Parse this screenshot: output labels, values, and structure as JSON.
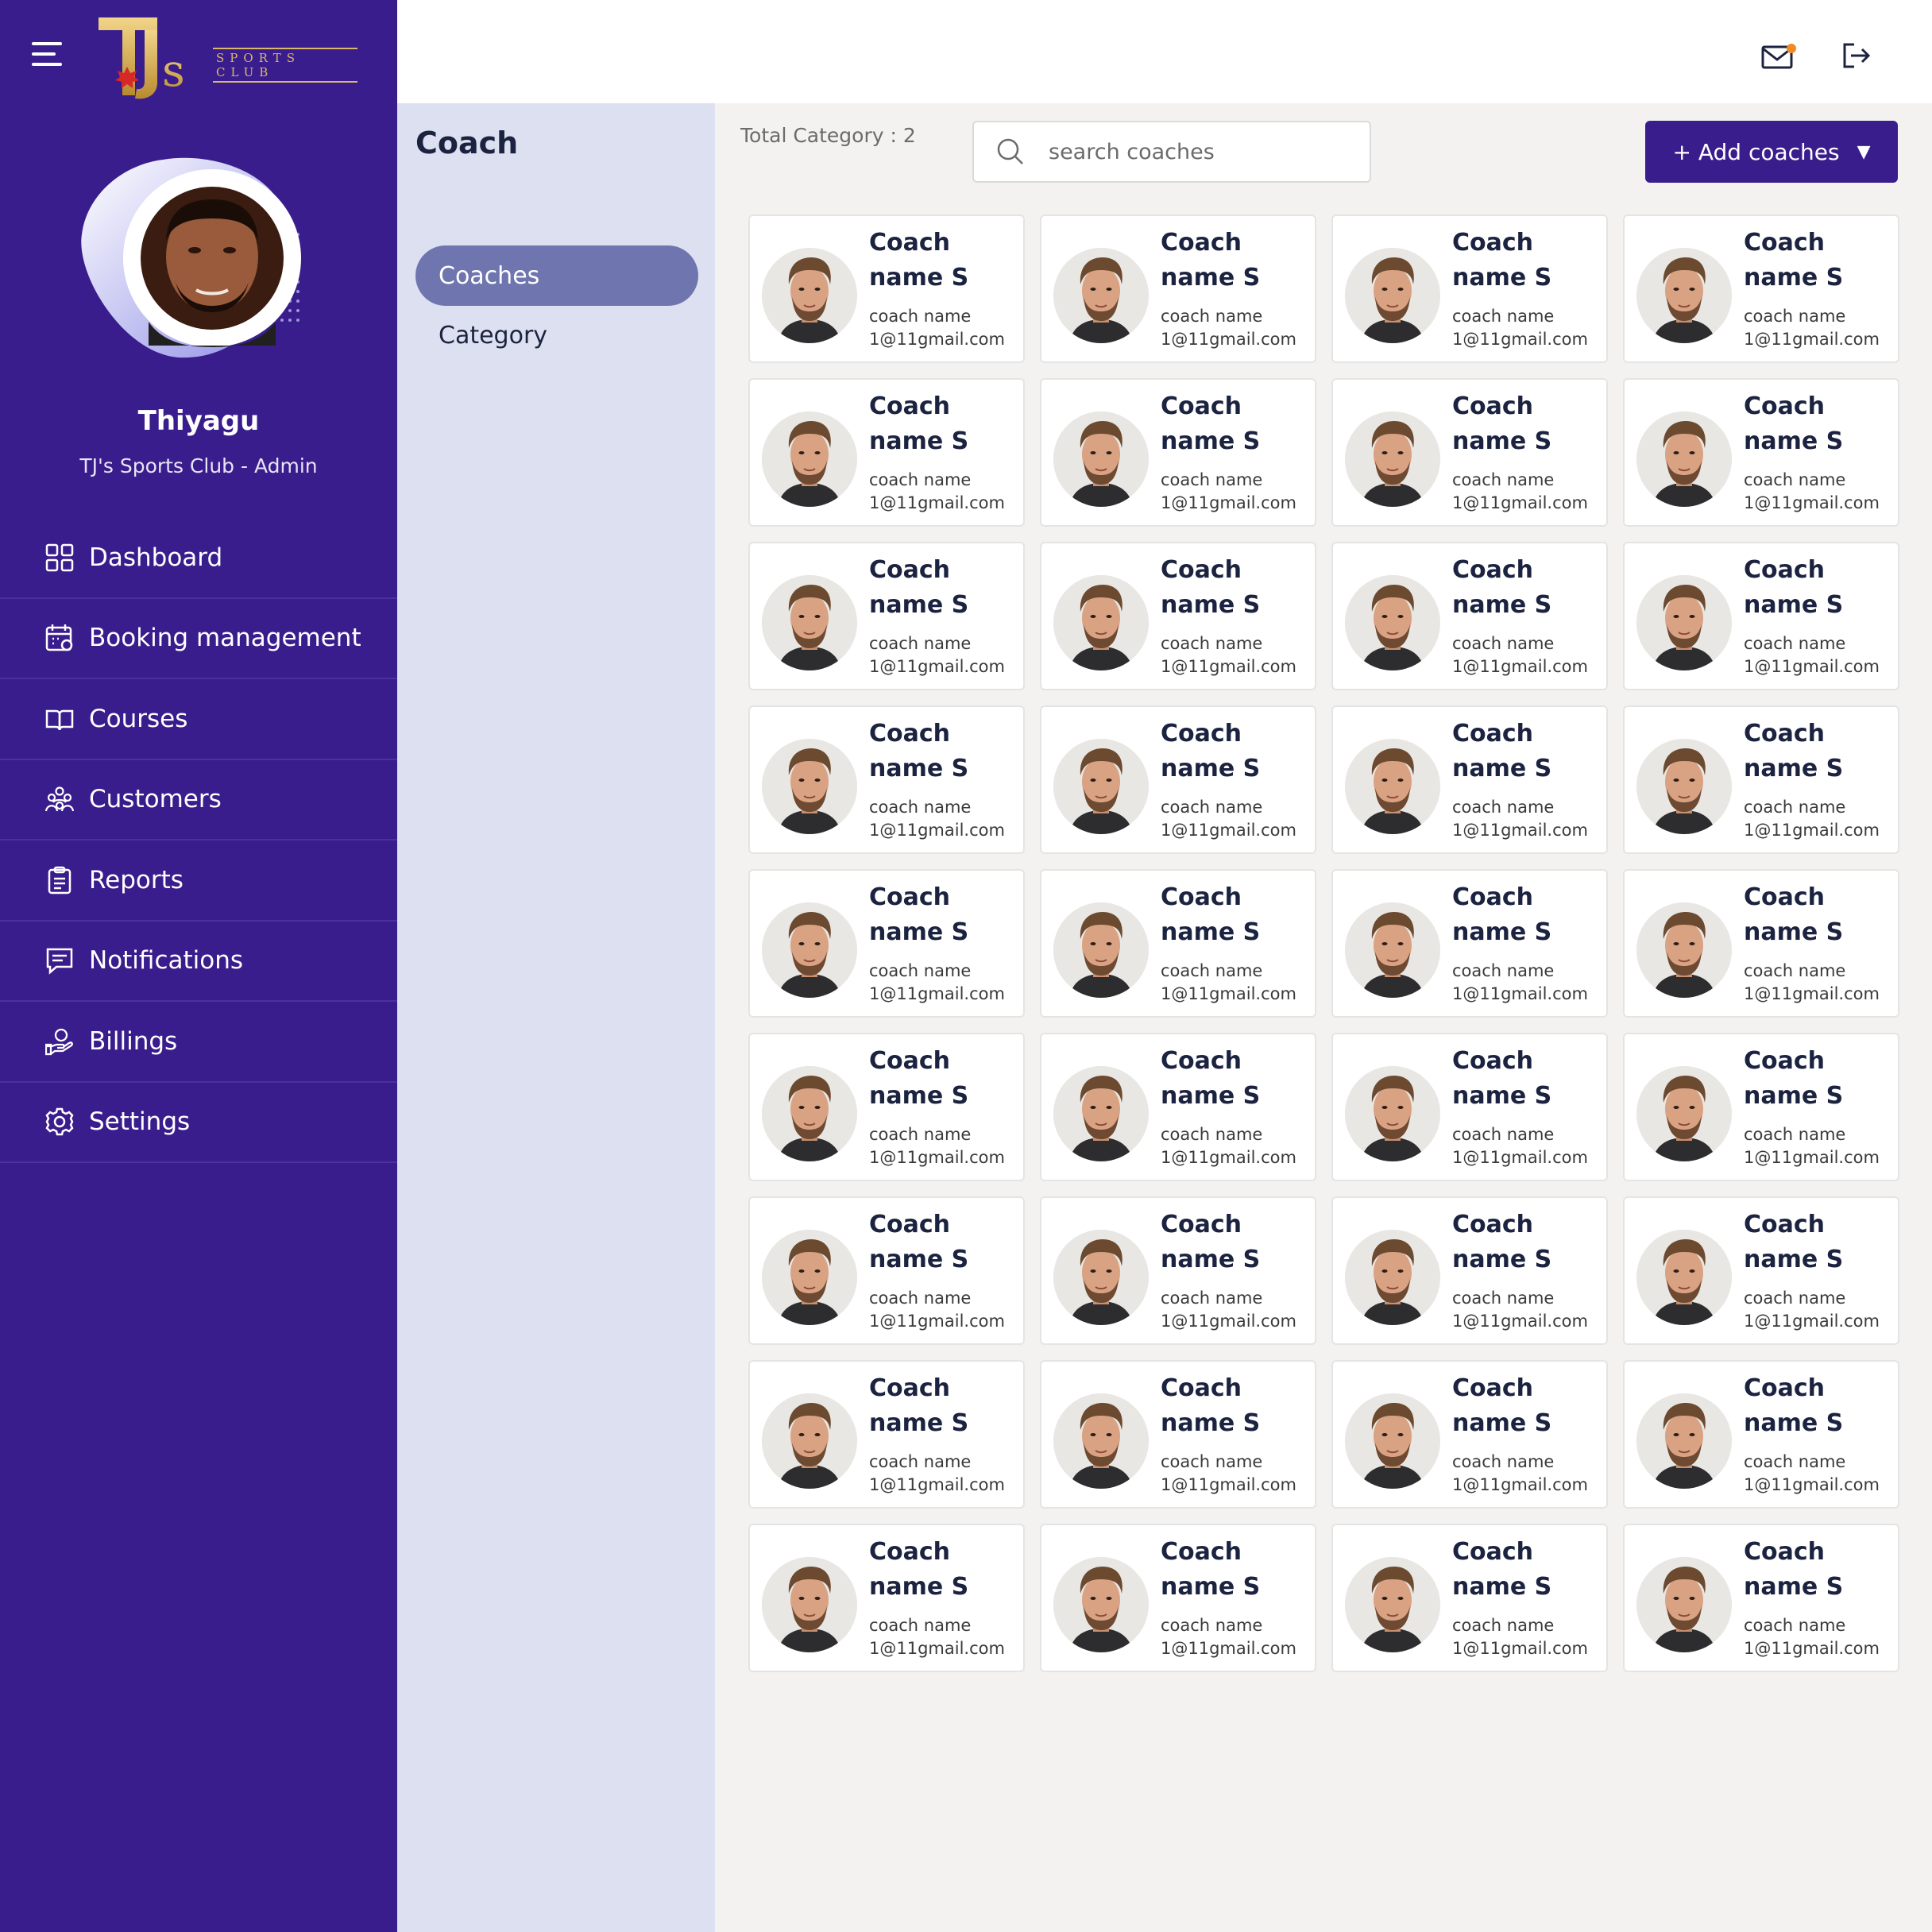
{
  "brand": {
    "logo_text": "SPORTS CLUB"
  },
  "user": {
    "name": "Thiyagu",
    "role": "TJ's Sports Club - Admin"
  },
  "nav": [
    {
      "label": "Dashboard",
      "icon": "dashboard-icon"
    },
    {
      "label": "Booking management",
      "icon": "calendar-icon"
    },
    {
      "label": "Courses",
      "icon": "book-icon"
    },
    {
      "label": "Customers",
      "icon": "users-icon"
    },
    {
      "label": "Reports",
      "icon": "clipboard-icon"
    },
    {
      "label": "Notifications",
      "icon": "chat-icon"
    },
    {
      "label": "Billings",
      "icon": "billing-hand-icon"
    },
    {
      "label": "Settings",
      "icon": "gear-icon"
    }
  ],
  "topbar": {
    "mail_icon": "mail-icon",
    "logout_icon": "logout-icon",
    "notification_dot_color": "#f08a24"
  },
  "subpanel": {
    "title": "Coach",
    "tabs": [
      {
        "label": "Coaches",
        "active": true
      },
      {
        "label": "Category",
        "active": false
      }
    ]
  },
  "main": {
    "total_category": "Total Category : 2",
    "search_placeholder": "search coaches",
    "add_button": "+ Add coaches",
    "cards": [
      {
        "name": "Coach name S",
        "subtitle": "coach name",
        "email": "1@11gmail.com"
      },
      {
        "name": "Coach name S",
        "subtitle": "coach name",
        "email": "1@11gmail.com"
      },
      {
        "name": "Coach name S",
        "subtitle": "coach name",
        "email": "1@11gmail.com"
      },
      {
        "name": "Coach name S",
        "subtitle": "coach name",
        "email": "1@11gmail.com"
      },
      {
        "name": "Coach name S",
        "subtitle": "coach name",
        "email": "1@11gmail.com"
      },
      {
        "name": "Coach name S",
        "subtitle": "coach name",
        "email": "1@11gmail.com"
      },
      {
        "name": "Coach name S",
        "subtitle": "coach name",
        "email": "1@11gmail.com"
      },
      {
        "name": "Coach name S",
        "subtitle": "coach name",
        "email": "1@11gmail.com"
      },
      {
        "name": "Coach name S",
        "subtitle": "coach name",
        "email": "1@11gmail.com"
      },
      {
        "name": "Coach name S",
        "subtitle": "coach name",
        "email": "1@11gmail.com"
      },
      {
        "name": "Coach name S",
        "subtitle": "coach name",
        "email": "1@11gmail.com"
      },
      {
        "name": "Coach name S",
        "subtitle": "coach name",
        "email": "1@11gmail.com"
      },
      {
        "name": "Coach name S",
        "subtitle": "coach name",
        "email": "1@11gmail.com"
      },
      {
        "name": "Coach name S",
        "subtitle": "coach name",
        "email": "1@11gmail.com"
      },
      {
        "name": "Coach name S",
        "subtitle": "coach name",
        "email": "1@11gmail.com"
      },
      {
        "name": "Coach name S",
        "subtitle": "coach name",
        "email": "1@11gmail.com"
      },
      {
        "name": "Coach name S",
        "subtitle": "coach name",
        "email": "1@11gmail.com"
      },
      {
        "name": "Coach name S",
        "subtitle": "coach name",
        "email": "1@11gmail.com"
      },
      {
        "name": "Coach name S",
        "subtitle": "coach name",
        "email": "1@11gmail.com"
      },
      {
        "name": "Coach name S",
        "subtitle": "coach name",
        "email": "1@11gmail.com"
      },
      {
        "name": "Coach name S",
        "subtitle": "coach name",
        "email": "1@11gmail.com"
      },
      {
        "name": "Coach name S",
        "subtitle": "coach name",
        "email": "1@11gmail.com"
      },
      {
        "name": "Coach name S",
        "subtitle": "coach name",
        "email": "1@11gmail.com"
      },
      {
        "name": "Coach name S",
        "subtitle": "coach name",
        "email": "1@11gmail.com"
      },
      {
        "name": "Coach name S",
        "subtitle": "coach name",
        "email": "1@11gmail.com"
      },
      {
        "name": "Coach name S",
        "subtitle": "coach name",
        "email": "1@11gmail.com"
      },
      {
        "name": "Coach name S",
        "subtitle": "coach name",
        "email": "1@11gmail.com"
      },
      {
        "name": "Coach name S",
        "subtitle": "coach name",
        "email": "1@11gmail.com"
      },
      {
        "name": "Coach name S",
        "subtitle": "coach name",
        "email": "1@11gmail.com"
      },
      {
        "name": "Coach name S",
        "subtitle": "coach name",
        "email": "1@11gmail.com"
      },
      {
        "name": "Coach name S",
        "subtitle": "coach name",
        "email": "1@11gmail.com"
      },
      {
        "name": "Coach name S",
        "subtitle": "coach name",
        "email": "1@11gmail.com"
      },
      {
        "name": "Coach name S",
        "subtitle": "coach name",
        "email": "1@11gmail.com"
      },
      {
        "name": "Coach name S",
        "subtitle": "coach name",
        "email": "1@11gmail.com"
      },
      {
        "name": "Coach name S",
        "subtitle": "coach name",
        "email": "1@11gmail.com"
      },
      {
        "name": "Coach name S",
        "subtitle": "coach name",
        "email": "1@11gmail.com"
      }
    ]
  },
  "colors": {
    "sidebar": "#3a1d8c",
    "accent": "#3a1d8c",
    "active_tab": "#6f75ae",
    "subpanel": "#dde0f0"
  }
}
